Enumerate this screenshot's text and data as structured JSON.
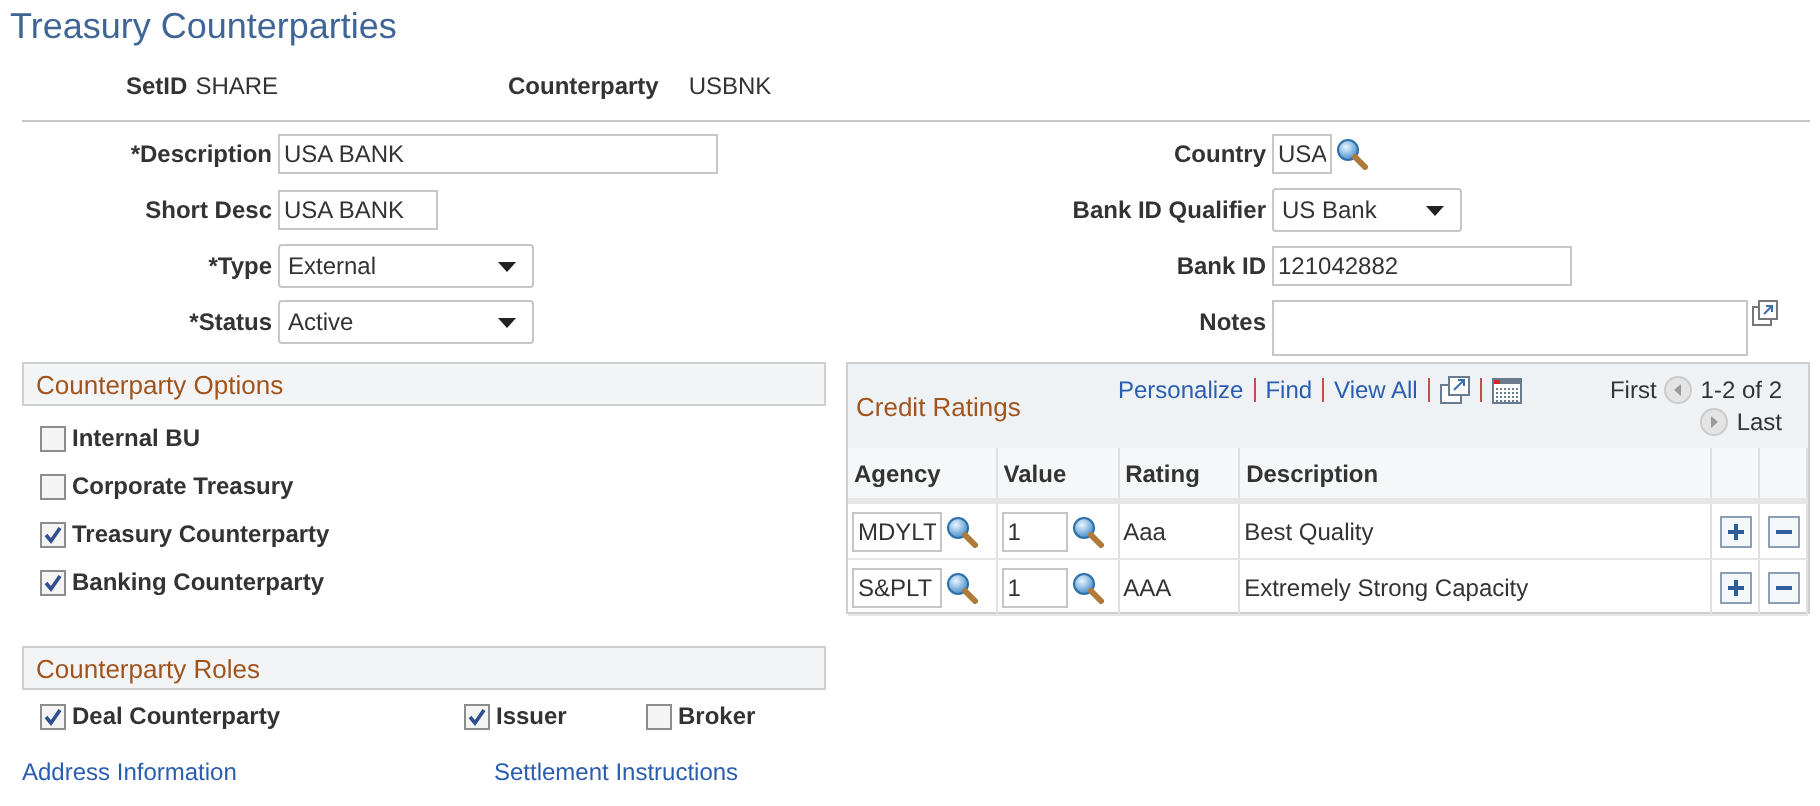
{
  "page_title": "Treasury Counterparties",
  "key_fields": [
    {
      "label": "SetID",
      "value": "SHARE"
    },
    {
      "label": "Counterparty",
      "value": "USBNK"
    }
  ],
  "form_rows": [
    {
      "left": {
        "label": "*Description",
        "kind": "text",
        "value": "USA BANK"
      },
      "right": {
        "label": "Country",
        "kind": "lookup",
        "value": "USA"
      }
    },
    {
      "left": {
        "label": "Short Desc",
        "kind": "text",
        "value": "USA BANK"
      },
      "right": {
        "label": "Bank ID Qualifier",
        "kind": "select",
        "value": "US Bank"
      }
    },
    {
      "left": {
        "label": "*Type",
        "kind": "select",
        "value": "External"
      },
      "right": {
        "label": "Bank ID",
        "kind": "text",
        "value": "121042882"
      }
    },
    {
      "left": {
        "label": "*Status",
        "kind": "select",
        "value": "Active"
      },
      "right": {
        "label": "Notes",
        "kind": "textarea"
      }
    }
  ],
  "counterparty_options": {
    "title": "Counterparty Options",
    "items": [
      {
        "label": "Internal BU",
        "checked": false
      },
      {
        "label": "Corporate Treasury",
        "checked": false
      },
      {
        "label": "Treasury Counterparty",
        "checked": true
      },
      {
        "label": "Banking Counterparty",
        "checked": true
      }
    ]
  },
  "counterparty_roles": {
    "title": "Counterparty Roles",
    "items": [
      {
        "label": "Deal Counterparty",
        "checked": true
      },
      {
        "label": "Issuer",
        "checked": true
      },
      {
        "label": "Broker",
        "checked": false
      }
    ]
  },
  "credit_ratings": {
    "title": "Credit Ratings",
    "toolbar_links": [
      "Personalize",
      "Find",
      "View All"
    ],
    "first": "First",
    "range": "1-2 of 2",
    "last": "Last",
    "columns": [
      "Agency",
      "Value",
      "Rating",
      "Description"
    ],
    "rows": [
      {
        "agency": "MDYLT",
        "value": "1",
        "rating": "Aaa",
        "description": "Best Quality"
      },
      {
        "agency": "S&PLT",
        "value": "1",
        "rating": "AAA",
        "description": "Extremely Strong Capacity"
      }
    ]
  },
  "links": [
    "Address Information",
    "Settlement Instructions"
  ]
}
